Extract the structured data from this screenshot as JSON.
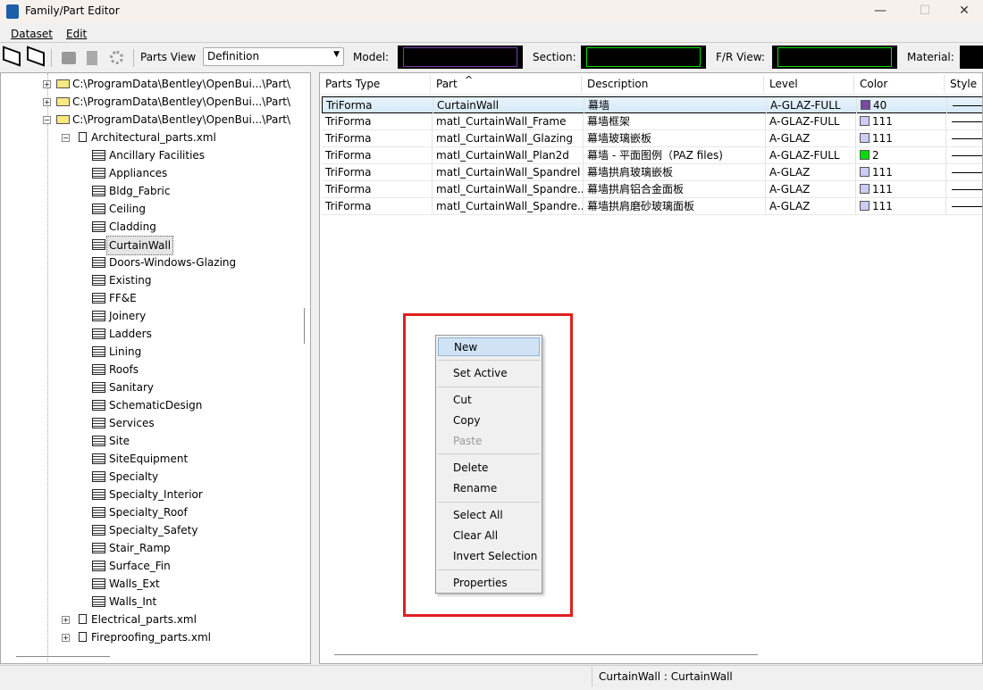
{
  "window": {
    "title": "Family/Part Editor",
    "minimize": "—",
    "maximize": "☐",
    "close": "✕"
  },
  "menubar": [
    "Dataset",
    "Edit"
  ],
  "toolbar": {
    "parts_view_label": "Parts View",
    "parts_view_value": "Definition",
    "model_label": "Model:",
    "section_label": "Section:",
    "frview_label": "F/R View:",
    "material_label": "Material:"
  },
  "tree": {
    "roots": [
      "C:\\ProgramData\\Bentley\\OpenBui...\\Part\\",
      "C:\\ProgramData\\Bentley\\OpenBui...\\Part\\",
      "C:\\ProgramData\\Bentley\\OpenBui...\\Part\\"
    ],
    "file": "Architectural_parts.xml",
    "families": [
      "Ancillary Facilities",
      "Appliances",
      "Bldg_Fabric",
      "Ceiling",
      "Cladding",
      "CurtainWall",
      "Doors-Windows-Glazing",
      "Existing",
      "FF&E",
      "Joinery",
      "Ladders",
      "Lining",
      "Roofs",
      "Sanitary",
      "SchematicDesign",
      "Services",
      "Site",
      "SiteEquipment",
      "Specialty",
      "Specialty_Interior",
      "Specialty_Roof",
      "Specialty_Safety",
      "Stair_Ramp",
      "Surface_Fin",
      "Walls_Ext",
      "Walls_Int"
    ],
    "selected": "CurtainWall",
    "other_files": [
      "Electrical_parts.xml",
      "Fireproofing_parts.xml"
    ]
  },
  "table": {
    "headers": [
      "Parts Type",
      "Part",
      "Description",
      "Level",
      "Color",
      "Style"
    ],
    "sort_indicator": "^",
    "rows": [
      {
        "type": "TriForma",
        "part": "CurtainWall",
        "desc": "幕墙",
        "level": "A-GLAZ-FULL",
        "color": "40",
        "swatch": "#7a4a9e"
      },
      {
        "type": "TriForma",
        "part": "matl_CurtainWall_Frame",
        "desc": "幕墙框架",
        "level": "A-GLAZ-FULL",
        "color": "111",
        "swatch": "#ccccf4"
      },
      {
        "type": "TriForma",
        "part": "matl_CurtainWall_Glazing",
        "desc": "幕墙玻璃嵌板",
        "level": "A-GLAZ",
        "color": "111",
        "swatch": "#ccccf4"
      },
      {
        "type": "TriForma",
        "part": "matl_CurtainWall_Plan2d",
        "desc": "幕墙 - 平面图例（PAZ files)",
        "level": "A-GLAZ-FULL",
        "color": "2",
        "swatch": "#00e000"
      },
      {
        "type": "TriForma",
        "part": "matl_CurtainWall_Spandrel",
        "desc": "幕墙拱肩玻璃嵌板",
        "level": "A-GLAZ",
        "color": "111",
        "swatch": "#ccccf4"
      },
      {
        "type": "TriForma",
        "part": "matl_CurtainWall_Spandre...",
        "desc": "幕墙拱肩铝合金面板",
        "level": "A-GLAZ",
        "color": "111",
        "swatch": "#ccccf4"
      },
      {
        "type": "TriForma",
        "part": "matl_CurtainWall_Spandre...",
        "desc": "幕墙拱肩磨砂玻璃面板",
        "level": "A-GLAZ",
        "color": "111",
        "swatch": "#ccccf4"
      }
    ]
  },
  "context_menu": {
    "items": [
      "New",
      "Set Active",
      "Cut",
      "Copy",
      "Paste",
      "Delete",
      "Rename",
      "Select All",
      "Clear All",
      "Invert Selection",
      "Properties"
    ],
    "disabled": [
      "Paste"
    ],
    "highlighted": "New"
  },
  "status": {
    "text": "CurtainWall : CurtainWall"
  }
}
